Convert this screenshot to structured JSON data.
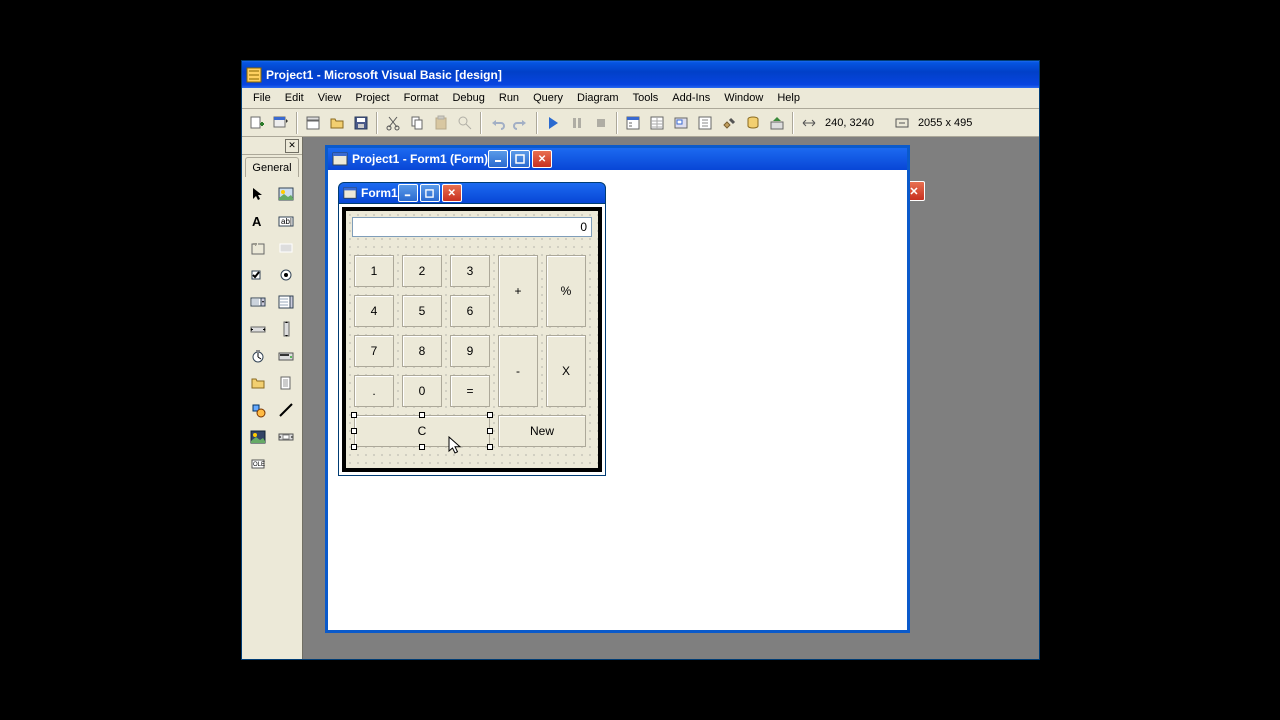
{
  "app": {
    "title": "Project1 - Microsoft Visual Basic [design]"
  },
  "menu": {
    "file": "File",
    "edit": "Edit",
    "view": "View",
    "project": "Project",
    "format": "Format",
    "debug": "Debug",
    "run": "Run",
    "query": "Query",
    "diagram": "Diagram",
    "tools": "Tools",
    "addins": "Add-Ins",
    "window": "Window",
    "help": "Help"
  },
  "toolbar": {
    "coords": "240, 3240",
    "size": "2055 x 495"
  },
  "toolbox": {
    "tab": "General"
  },
  "designer": {
    "title": "Project1 - Form1 (Form)"
  },
  "form": {
    "title": "Form1",
    "display": "0",
    "btns": {
      "n1": "1",
      "n2": "2",
      "n3": "3",
      "n4": "4",
      "n5": "5",
      "n6": "6",
      "n7": "7",
      "n8": "8",
      "n9": "9",
      "n0": "0",
      "dot": ".",
      "eq": "=",
      "plus": "+",
      "minus": "-",
      "mul": "X",
      "pct": "%",
      "clear": "C",
      "new": "New"
    }
  }
}
